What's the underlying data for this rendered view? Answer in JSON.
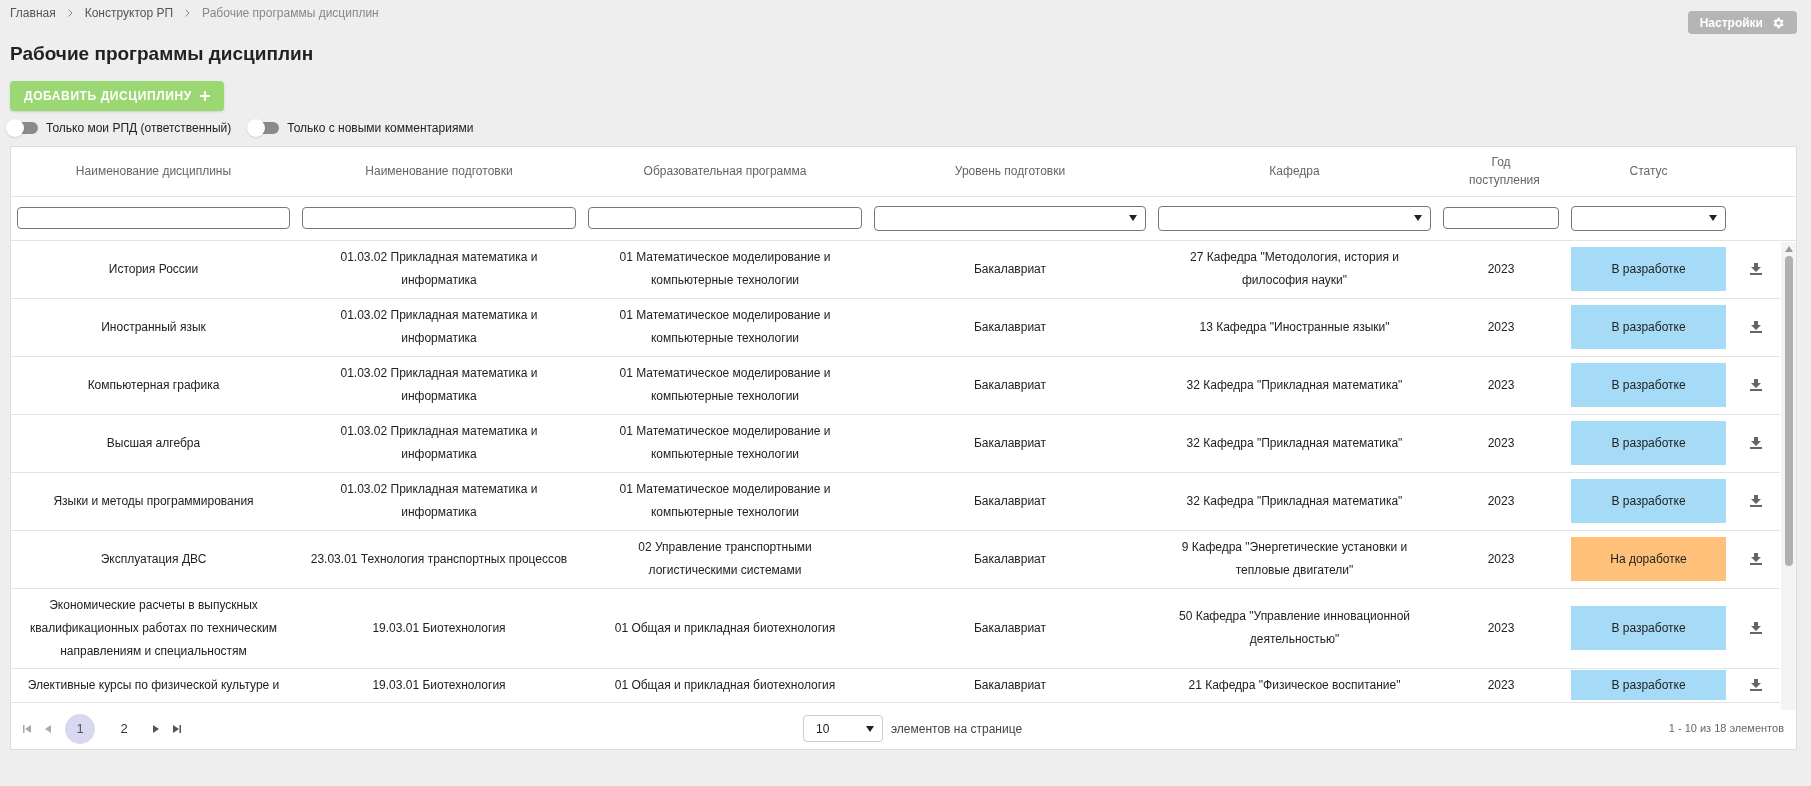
{
  "breadcrumbs": [
    {
      "label": "Главная",
      "current": false
    },
    {
      "label": "Конструктор РП",
      "current": false
    },
    {
      "label": "Рабочие программы дисциплин",
      "current": true
    }
  ],
  "settings_button": "Настройки",
  "title": "Рабочие программы дисциплин",
  "add_button": "ДОБАВИТЬ ДИСЦИПЛИНУ",
  "toggles": [
    {
      "label": "Только мои РПД (ответственный)",
      "on": false
    },
    {
      "label": "Только с новыми комментариями",
      "on": false
    }
  ],
  "table": {
    "columns": [
      "Наименование дисциплины",
      "Наименование подготовки",
      "Образовательная программа",
      "Уровень подготовки",
      "Кафедра",
      "Год поступления",
      "Статус"
    ],
    "filters": [
      {
        "kind": "text"
      },
      {
        "kind": "text"
      },
      {
        "kind": "text"
      },
      {
        "kind": "select"
      },
      {
        "kind": "select"
      },
      {
        "kind": "text"
      },
      {
        "kind": "select"
      }
    ],
    "rows": [
      {
        "discipline": "История России",
        "training": "01.03.02 Прикладная математика и информатика",
        "program": "01 Математическое моделирование и компьютерные технологии",
        "level": "Бакалавриат",
        "department": "27 Кафедра \"Методология, история и философия науки\"",
        "year": "2023",
        "status": "В разработке",
        "color": "#a6dbf7"
      },
      {
        "discipline": "Иностранный язык",
        "training": "01.03.02 Прикладная математика и информатика",
        "program": "01 Математическое моделирование и компьютерные технологии",
        "level": "Бакалавриат",
        "department": "13 Кафедра \"Иностранные языки\"",
        "year": "2023",
        "status": "В разработке",
        "color": "#a6dbf7"
      },
      {
        "discipline": "Компьютерная графика",
        "training": "01.03.02 Прикладная математика и информатика",
        "program": "01 Математическое моделирование и компьютерные технологии",
        "level": "Бакалавриат",
        "department": "32 Кафедра \"Прикладная математика\"",
        "year": "2023",
        "status": "В разработке",
        "color": "#a6dbf7"
      },
      {
        "discipline": "Высшая алгебра",
        "training": "01.03.02 Прикладная математика и информатика",
        "program": "01 Математическое моделирование и компьютерные технологии",
        "level": "Бакалавриат",
        "department": "32 Кафедра \"Прикладная математика\"",
        "year": "2023",
        "status": "В разработке",
        "color": "#a6dbf7"
      },
      {
        "discipline": "Языки и методы программирования",
        "training": "01.03.02 Прикладная математика и информатика",
        "program": "01 Математическое моделирование и компьютерные технологии",
        "level": "Бакалавриат",
        "department": "32 Кафедра \"Прикладная математика\"",
        "year": "2023",
        "status": "В разработке",
        "color": "#a6dbf7"
      },
      {
        "discipline": "Эксплуатация ДВС",
        "training": "23.03.01 Технология транспортных процессов",
        "program": "02 Управление транспортными логистическими системами",
        "level": "Бакалавриат",
        "department": "9 Кафедра \"Энергетические установки и тепловые двигатели\"",
        "year": "2023",
        "status": "На доработке",
        "color": "#ffc179"
      },
      {
        "discipline": "Экономические расчеты в выпускных квалификационных работах по техническим направлениям и специальностям",
        "training": "19.03.01 Биотехнология",
        "program": "01 Общая и прикладная биотехнология",
        "level": "Бакалавриат",
        "department": "50 Кафедра \"Управление инновационной деятельностью\"",
        "year": "2023",
        "status": "В разработке",
        "color": "#a6dbf7"
      },
      {
        "discipline": "Элективные курсы по физической культуре и",
        "training": "19.03.01 Биотехнология",
        "program": "01 Общая и прикладная биотехнология",
        "level": "Бакалавриат",
        "department": "21 Кафедра \"Физическое воспитание\"",
        "year": "2023",
        "status": "В разработке",
        "color": "#a6dbf7"
      }
    ]
  },
  "pagination": {
    "pages": [
      {
        "label": "1",
        "selected": true
      },
      {
        "label": "2",
        "selected": false
      }
    ],
    "page_size": "10",
    "page_size_label": "элементов на странице",
    "summary": "1 - 10 из 18 элементов"
  }
}
